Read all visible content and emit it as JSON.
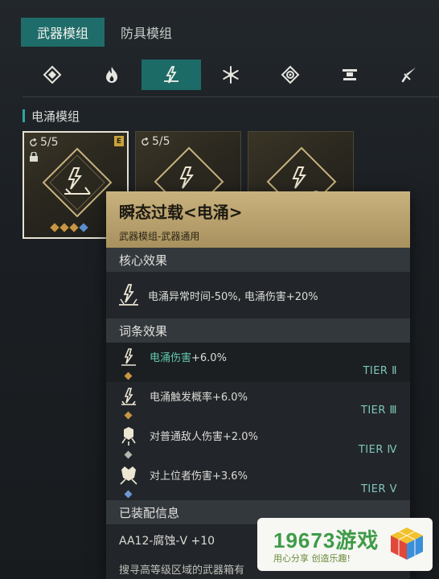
{
  "top_tabs": [
    {
      "label": "武器模组",
      "active": true
    },
    {
      "label": "防具模组",
      "active": false
    }
  ],
  "categories": [
    {
      "icon": "diamond-core-icon"
    },
    {
      "icon": "flame-icon"
    },
    {
      "icon": "lightning-icon",
      "active": true
    },
    {
      "icon": "snowflake-icon"
    },
    {
      "icon": "gear-diamond-icon"
    },
    {
      "icon": "turret-icon"
    },
    {
      "icon": "blade-icon"
    }
  ],
  "section_title": "电涌模组",
  "cards": [
    {
      "count": "5/5",
      "badge": "E",
      "selected": true,
      "locked": true
    },
    {
      "count": "5/5",
      "selected": false
    },
    {
      "count": "",
      "selected": false
    }
  ],
  "tooltip": {
    "title": "瞬态过载<电涌>",
    "subtitle": "武器模组-武器通用",
    "core_heading": "核心效果",
    "core_text": "电涌异常时间-50%, 电涌伤害+20%",
    "affix_heading": "词条效果",
    "affixes": [
      {
        "text_green": "电涌伤害",
        "text_rest": "+6.0%",
        "tier": "TIER Ⅱ",
        "gem": "gold"
      },
      {
        "text_green": "",
        "text_rest": "电涌触发概率+6.0%",
        "tier": "TIER Ⅲ",
        "gem": "gold"
      },
      {
        "text_green": "",
        "text_rest": "对普通敌人伤害+2.0%",
        "tier": "TIER Ⅳ",
        "gem": "grey"
      },
      {
        "text_green": "",
        "text_rest": "对上位者伤害+3.6%",
        "tier": "TIER Ⅴ",
        "gem": "blue"
      }
    ],
    "equip_heading": "已装配信息",
    "equip_text": "AA12-腐蚀-V +10",
    "hint_text": "搜寻高等级区域的武器箱有"
  },
  "watermark": {
    "title": "19673游戏",
    "slogan": "用心分享  创造乐趣!"
  },
  "colors": {
    "accent_teal": "#1f6d6a",
    "tooltip_header": "#c9b27e",
    "tier_text": "#7fc7bc",
    "gem_gold": "#c89642"
  }
}
